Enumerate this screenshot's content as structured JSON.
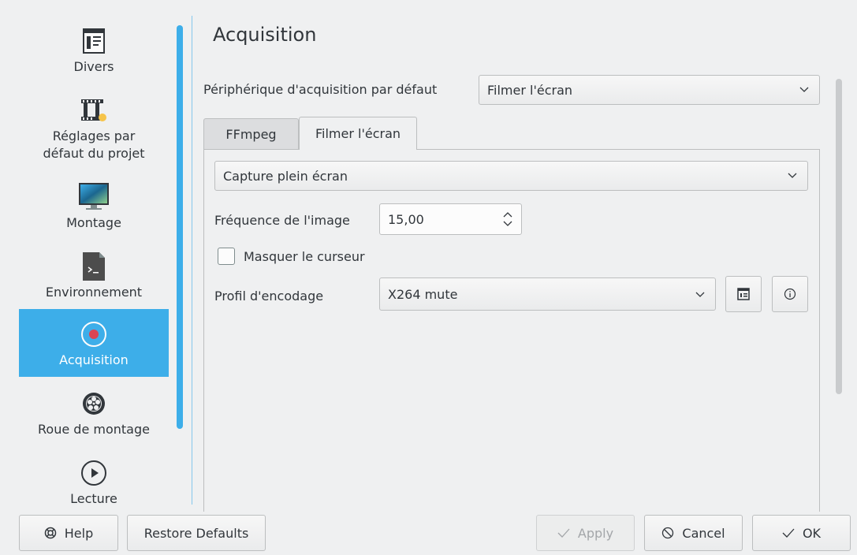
{
  "sidebar": {
    "items": [
      {
        "label": "Divers",
        "icon": "general-settings-icon"
      },
      {
        "label": "Réglages par\ndéfaut du projet",
        "icon": "film-icon"
      },
      {
        "label": "Montage",
        "icon": "monitor-icon"
      },
      {
        "label": "Environnement",
        "icon": "terminal-icon"
      },
      {
        "label": "Acquisition",
        "icon": "record-icon",
        "active": true
      },
      {
        "label": "Roue de montage",
        "icon": "jog-wheel-icon"
      },
      {
        "label": "Lecture",
        "icon": "play-icon"
      }
    ]
  },
  "page": {
    "title": "Acquisition",
    "default_device_label": "Périphérique d'acquisition par défaut",
    "default_device_value": "Filmer l'écran"
  },
  "tabs": [
    {
      "label": "FFmpeg",
      "active": false
    },
    {
      "label": "Filmer l'écran",
      "active": true
    }
  ],
  "screen_grab": {
    "capture_mode": "Capture plein écran",
    "frame_rate_label": "Fréquence de l'image",
    "frame_rate_value": "15,00",
    "hide_cursor_label": "Masquer le curseur",
    "hide_cursor_checked": false,
    "encoding_profile_label": "Profil d'encodage",
    "encoding_profile_value": "X264 mute"
  },
  "buttons": {
    "help": "Help",
    "restore_defaults": "Restore Defaults",
    "apply": "Apply",
    "cancel": "Cancel",
    "ok": "OK"
  },
  "colors": {
    "accent": "#3daee9",
    "background": "#eff0f1",
    "record": "#da4453"
  }
}
